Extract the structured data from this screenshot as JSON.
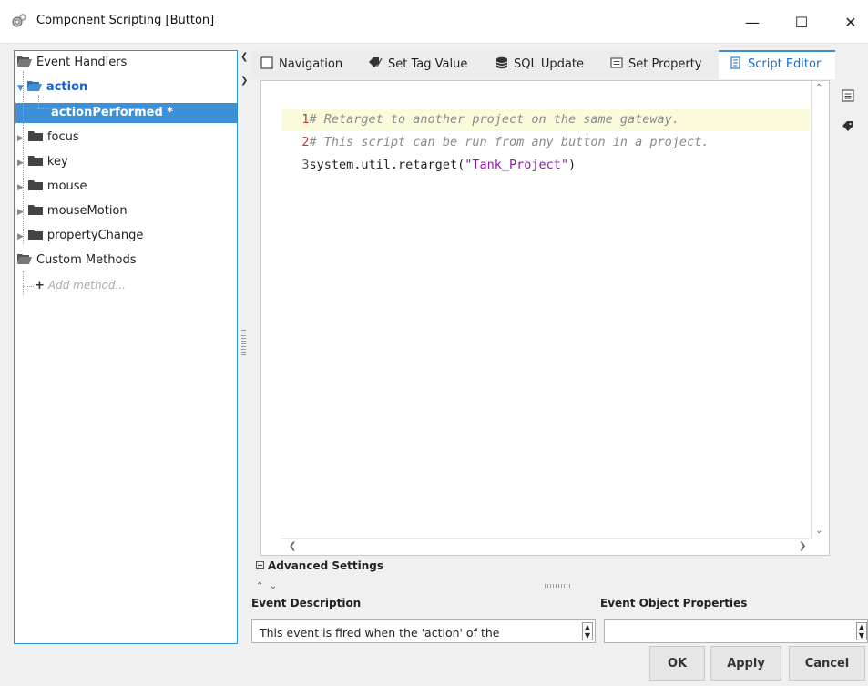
{
  "window": {
    "title": "Component Scripting [Button]",
    "controls": {
      "minimize": "—",
      "maximize": "☐",
      "close": "✕"
    }
  },
  "tree": {
    "root": "Event Handlers",
    "items": [
      {
        "label": "action"
      },
      {
        "label": "actionPerformed *"
      },
      {
        "label": "focus"
      },
      {
        "label": "key"
      },
      {
        "label": "mouse"
      },
      {
        "label": "mouseMotion"
      },
      {
        "label": "propertyChange"
      }
    ],
    "custom_methods": "Custom Methods",
    "add_method": "Add method..."
  },
  "tabs": [
    {
      "label": "Navigation"
    },
    {
      "label": "Set Tag Value"
    },
    {
      "label": "SQL Update"
    },
    {
      "label": "Set Property"
    },
    {
      "label": "Script Editor",
      "active": true
    }
  ],
  "editor": {
    "lines": [
      {
        "num": "1",
        "text": "# Retarget to another project on the same gateway."
      },
      {
        "num": "2",
        "text": "# This script can be run from any button in a project."
      },
      {
        "num": "3",
        "code_prefix": "system.util.retarget(",
        "string": "\"Tank_Project\"",
        "code_suffix": ")"
      }
    ]
  },
  "advanced_settings": "Advanced Settings",
  "event_description_label": "Event Description",
  "event_object_properties_label": "Event Object Properties",
  "event_description_value": "This event is fired when the 'action' of the",
  "buttons": {
    "ok": "OK",
    "apply": "Apply",
    "cancel": "Cancel"
  },
  "colors": {
    "accent": "#3d8fd8",
    "selection": "#3d8fd8",
    "active_tab_text": "#1a6fd0",
    "line_number": "#c0392b",
    "comment": "#8a8a8a",
    "string": "#8a1ea0",
    "current_line": "#fbfbdc"
  },
  "icons": [
    "app-icon",
    "folder-open-icon",
    "folder-icon",
    "plus-icon",
    "checkbox-icon",
    "tag-write-icon",
    "database-icon",
    "property-icon",
    "script-icon",
    "list-icon",
    "tag-icon"
  ]
}
